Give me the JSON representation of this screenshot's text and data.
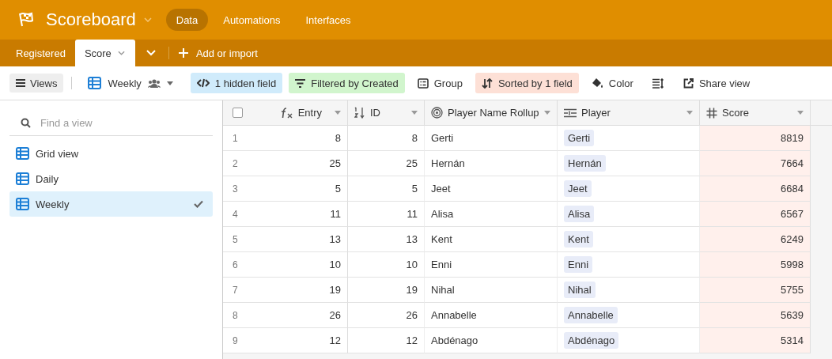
{
  "app": {
    "title": "Scoreboard"
  },
  "nav": [
    {
      "label": "Data",
      "selected": true
    },
    {
      "label": "Automations",
      "selected": false
    },
    {
      "label": "Interfaces",
      "selected": false
    }
  ],
  "tables": [
    {
      "label": "Registered",
      "selected": false
    },
    {
      "label": "Score",
      "selected": true
    }
  ],
  "add_button": "Add or import",
  "toolbar": {
    "views_button": "Views",
    "view_name": "Weekly",
    "buttons": [
      {
        "kind": "hidden",
        "label": "1 hidden field"
      },
      {
        "kind": "filter",
        "label": "Filtered by Created"
      },
      {
        "kind": "group",
        "label": "Group"
      },
      {
        "kind": "sort",
        "label": "Sorted by 1 field"
      },
      {
        "kind": "color",
        "label": "Color"
      },
      {
        "kind": "height"
      },
      {
        "kind": "share",
        "label": "Share view"
      }
    ]
  },
  "sidebar": {
    "search": {
      "placeholder": "Find a view"
    },
    "items": [
      {
        "label": "Grid view",
        "selected": false
      },
      {
        "label": "Daily",
        "selected": false
      },
      {
        "label": "Weekly",
        "selected": true
      }
    ]
  },
  "table": {
    "select_all": {
      "checked": false
    },
    "columns": [
      {
        "kind": "formula",
        "label": "Entry",
        "sorted": false
      },
      {
        "kind": "autonumber",
        "label": "ID",
        "sorted": false
      },
      {
        "kind": "rollup",
        "label": "Player Name Rollup",
        "sorted": false
      },
      {
        "kind": "link",
        "label": "Player",
        "sorted": false
      },
      {
        "kind": "number",
        "label": "Score",
        "sorted": true
      }
    ],
    "rows": [
      {
        "num": "1",
        "cells": [
          "8",
          "8",
          "Gerti",
          "Gerti",
          "8819"
        ]
      },
      {
        "num": "2",
        "cells": [
          "25",
          "25",
          "Hernán",
          "Hernán",
          "7664"
        ]
      },
      {
        "num": "3",
        "cells": [
          "5",
          "5",
          "Jeet",
          "Jeet",
          "6684"
        ]
      },
      {
        "num": "4",
        "cells": [
          "11",
          "11",
          "Alisa",
          "Alisa",
          "6567"
        ]
      },
      {
        "num": "5",
        "cells": [
          "13",
          "13",
          "Kent",
          "Kent",
          "6249"
        ]
      },
      {
        "num": "6",
        "cells": [
          "10",
          "10",
          "Enni",
          "Enni",
          "5998"
        ]
      },
      {
        "num": "7",
        "cells": [
          "19",
          "19",
          "Nihal",
          "Nihal",
          "5755"
        ]
      },
      {
        "num": "8",
        "cells": [
          "26",
          "26",
          "Annabelle",
          "Annabelle",
          "5639"
        ]
      },
      {
        "num": "9",
        "cells": [
          "12",
          "12",
          "Abdénago",
          "Abdénago",
          "5314"
        ]
      }
    ]
  }
}
